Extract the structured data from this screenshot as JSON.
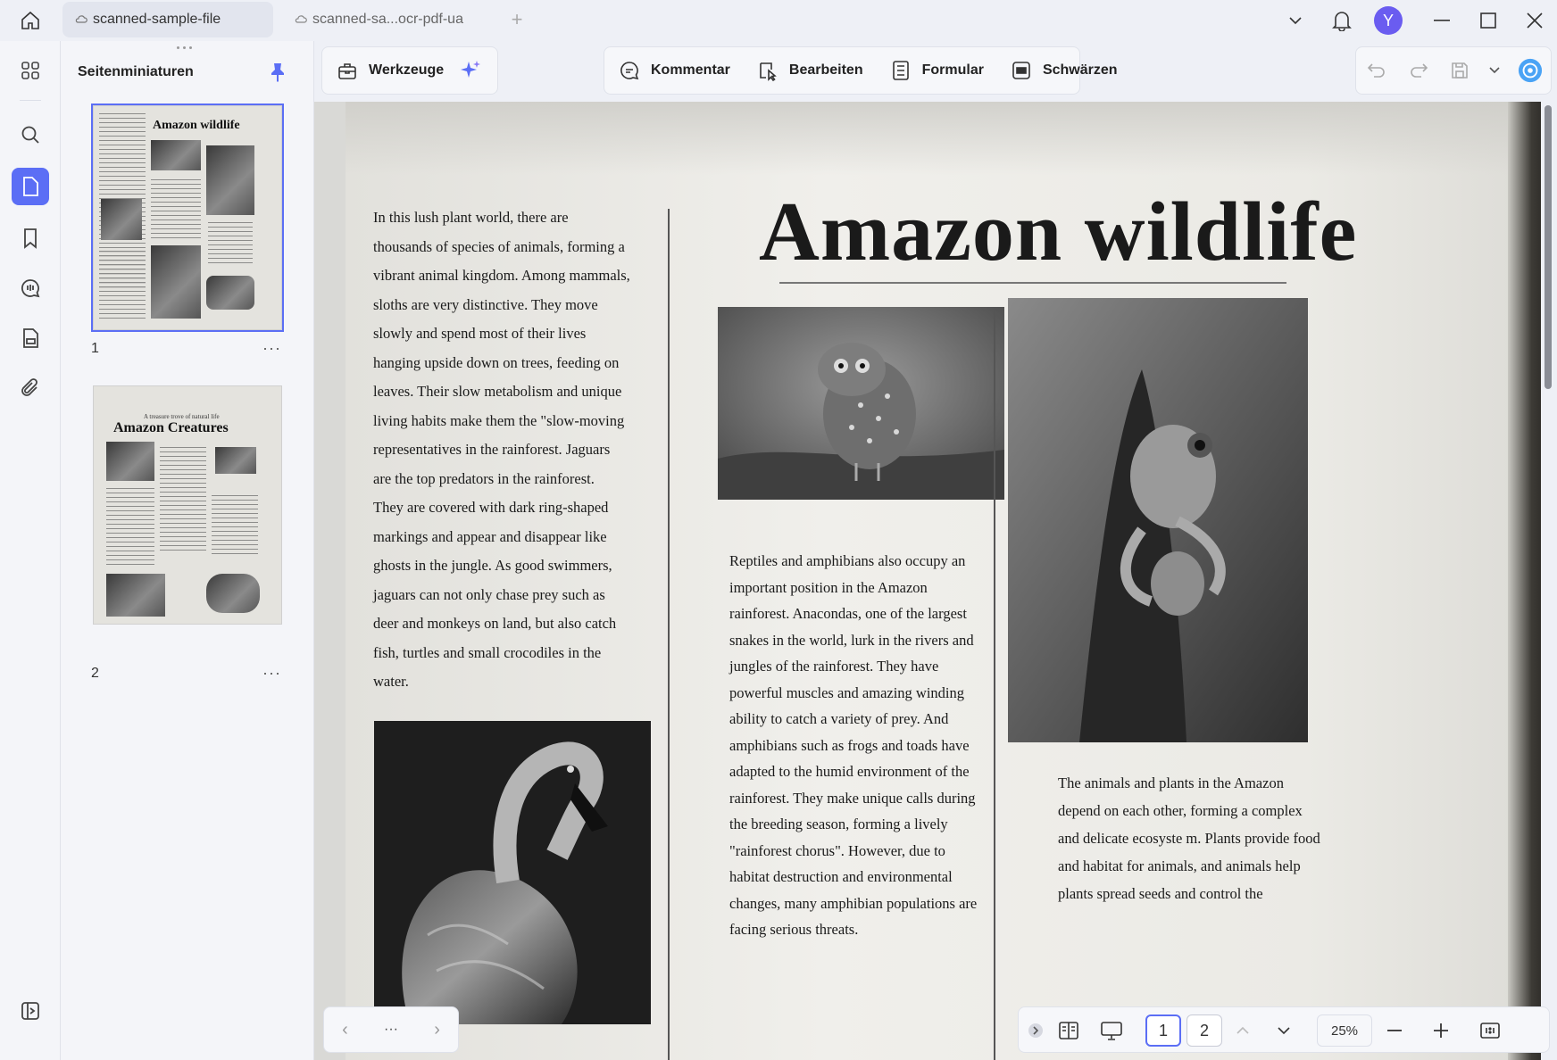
{
  "titlebar": {
    "tabs": [
      {
        "label": "scanned-sample-file",
        "active": true
      },
      {
        "label": "scanned-sa...ocr-pdf-ua",
        "active": false
      }
    ],
    "new_tab": "+",
    "avatar_initial": "Y",
    "avatar_color": "#6a5cf0"
  },
  "rail": {
    "items": [
      "apps-icon",
      "search-icon",
      "pages-icon",
      "bookmark-icon",
      "comment-icon",
      "form-icon",
      "attachment-icon"
    ],
    "active": "pages-icon",
    "accent": "#5b6ef5"
  },
  "panel": {
    "title": "Seitenminiaturen",
    "pages": [
      {
        "number": "1",
        "title": "Amazon wildlife",
        "selected": true
      },
      {
        "number": "2",
        "title": "Amazon Creatures",
        "subtitle": "A treasure trove of natural life",
        "selected": false
      }
    ],
    "more": "···"
  },
  "toolbar": {
    "werkzeuge": "Werkzeuge",
    "kommentar": "Kommentar",
    "bearbeiten": "Bearbeiten",
    "formular": "Formular",
    "schwaerzen": "Schwärzen"
  },
  "document": {
    "headline": "Amazon wildlife",
    "col1": [
      "In this lush plant world, there are",
      "thousands of species of animals, forming a",
      "vibrant animal kingdom. Among mammals,",
      "sloths are very distinctive. They move",
      "slowly and spend most of their lives",
      "hanging upside down on trees, feeding on",
      "leaves. Their slow metabolism and unique",
      "living habits make them the \"slow-moving",
      "representatives in the rainforest. Jaguars",
      "are the top predators in the rainforest.",
      "They are covered with dark ring-shaped",
      "markings and appear and disappear like",
      "ghosts in the jungle. As good swimmers,",
      "jaguars can not only chase prey such as",
      "deer and monkeys on land, but also catch",
      "fish, turtles and small crocodiles in the",
      "water."
    ],
    "col2": [
      "Reptiles and amphibians also occupy an",
      "important position in the Amazon",
      "rainforest. Anacondas, one of the largest",
      "snakes in the world, lurk in the rivers and",
      "jungles of the rainforest. They have",
      "powerful muscles and amazing winding",
      "ability to catch a variety of prey. And",
      "amphibians such as frogs and toads have",
      "adapted to the humid environment of the",
      "rainforest. They make unique calls during",
      "the breeding season, forming a lively",
      "\"rainforest chorus\". However, due to",
      "habitat destruction and environmental",
      "changes, many amphibian populations are",
      "facing serious threats."
    ],
    "col3": [
      "The animals and plants in the Amazon",
      "depend on each other, forming a complex",
      "and delicate ecosyste m. Plants provide food",
      "and habitat for animals, and animals help",
      "plants spread seeds and control the"
    ]
  },
  "navbar": {
    "prev": "‹",
    "more": "···",
    "next": "›"
  },
  "bottombar": {
    "page1": "1",
    "page2": "2",
    "zoom": "25%"
  }
}
